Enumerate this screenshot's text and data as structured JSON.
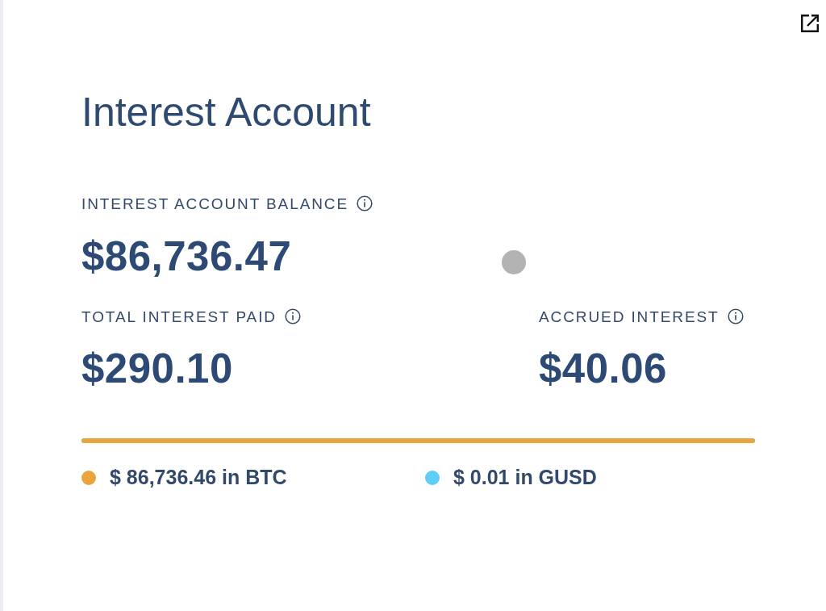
{
  "title": "Interest Account",
  "balance": {
    "label": "INTEREST ACCOUNT BALANCE",
    "value": "$86,736.47"
  },
  "stats": [
    {
      "label": "TOTAL INTEREST PAID",
      "value": "$290.10"
    },
    {
      "label": "ACCRUED INTEREST",
      "value": "$40.06"
    }
  ],
  "allocation_bar": {
    "level": 1
  },
  "holdings": [
    {
      "text": "$ 86,736.46 in BTC",
      "color": "#e8a53f"
    },
    {
      "text": "$ 0.01 in GUSD",
      "color": "#5fcdf8"
    }
  ]
}
